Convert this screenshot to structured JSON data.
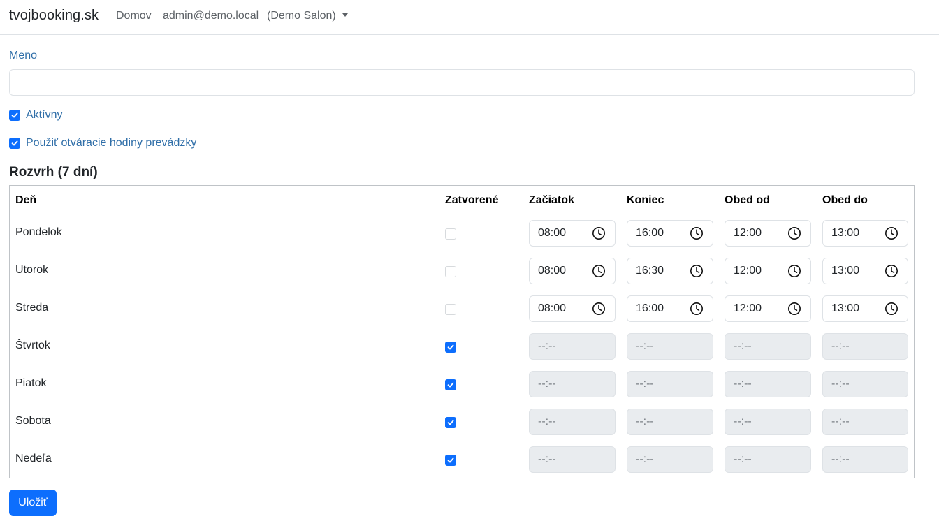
{
  "navbar": {
    "brand": "tvojbooking.sk",
    "home": "Domov",
    "user": "admin@demo.local",
    "salon": "(Demo Salon)"
  },
  "form": {
    "name_label": "Meno",
    "name_value": "",
    "active_label": "Aktívny",
    "active_checked": true,
    "use_hours_label": "Použiť otváracie hodiny prevádzky",
    "use_hours_checked": true
  },
  "schedule": {
    "title": "Rozvrh (7 dní)",
    "headers": {
      "day": "Deň",
      "closed": "Zatvorené",
      "start": "Začiatok",
      "end": "Koniec",
      "lunch_start": "Obed od",
      "lunch_end": "Obed do"
    },
    "rows": [
      {
        "day": "Pondelok",
        "closed": false,
        "start": "08:00",
        "end": "16:00",
        "lunch_start": "12:00",
        "lunch_end": "13:00"
      },
      {
        "day": "Utorok",
        "closed": false,
        "start": "08:00",
        "end": "16:30",
        "lunch_start": "12:00",
        "lunch_end": "13:00"
      },
      {
        "day": "Streda",
        "closed": false,
        "start": "08:00",
        "end": "16:00",
        "lunch_start": "12:00",
        "lunch_end": "13:00"
      },
      {
        "day": "Štvrtok",
        "closed": true,
        "start": "--:--",
        "end": "--:--",
        "lunch_start": "--:--",
        "lunch_end": "--:--"
      },
      {
        "day": "Piatok",
        "closed": true,
        "start": "--:--",
        "end": "--:--",
        "lunch_start": "--:--",
        "lunch_end": "--:--"
      },
      {
        "day": "Sobota",
        "closed": true,
        "start": "--:--",
        "end": "--:--",
        "lunch_start": "--:--",
        "lunch_end": "--:--"
      },
      {
        "day": "Nedeľa",
        "closed": true,
        "start": "--:--",
        "end": "--:--",
        "lunch_start": "--:--",
        "lunch_end": "--:--"
      }
    ]
  },
  "save_label": "Uložiť",
  "icons": {
    "clock": "clock-icon",
    "caret": "chevron-down-icon",
    "check": "check-icon"
  },
  "colors": {
    "primary": "#0d6efd",
    "label_link": "#2f6ea8",
    "disabled_bg": "#e9ecef"
  }
}
